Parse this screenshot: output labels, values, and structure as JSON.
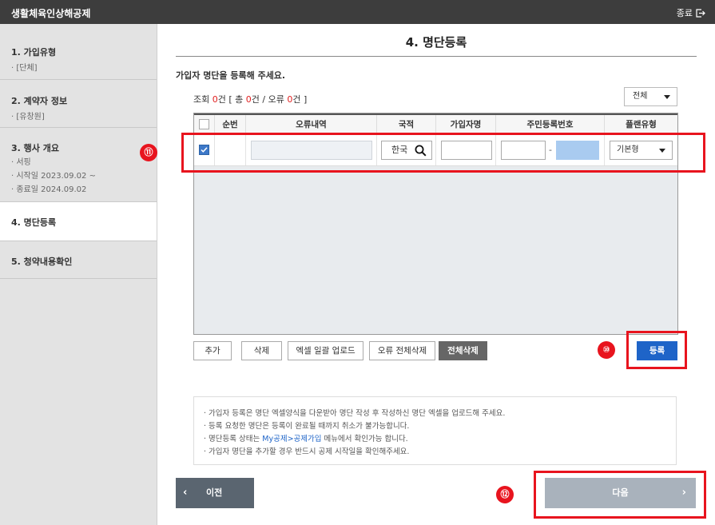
{
  "window": {
    "title": "생활체육인상해공제",
    "exit_label": "종료"
  },
  "sidebar": {
    "steps": [
      {
        "label": "1. 가입유형",
        "details": [
          "· [단체]"
        ]
      },
      {
        "label": "2. 계약자 정보",
        "details": [
          "· [유창원]"
        ]
      },
      {
        "label": "3. 행사 개요",
        "details": [
          "· 서핑",
          "· 시작일 2023.09.02 ~",
          "· 종료일 2024.09.02"
        ]
      },
      {
        "label": "4. 명단등록",
        "details": [],
        "active": true
      },
      {
        "label": "5. 청약내용확인",
        "details": []
      }
    ]
  },
  "main": {
    "title": "4. 명단등록",
    "intro": "가입자 명단을 등록해 주세요.",
    "count": {
      "prefix": "조회 ",
      "found": "0",
      "mid1": "건 [ 총 ",
      "total": "0",
      "mid2": "건 / 오류 ",
      "errors": "0",
      "suffix": "건 ]"
    },
    "filter": {
      "selected": "전체"
    },
    "table": {
      "columns": [
        "순번",
        "오류내역",
        "국적",
        "가입자명",
        "주민등록번호",
        "플랜유형"
      ],
      "rows": [
        {
          "checked": true,
          "seq": "",
          "error": "",
          "nationality": "한국",
          "name": "",
          "rrn_front": "",
          "rrn_sep": "-",
          "rrn_back": "",
          "plan": "기본형"
        }
      ]
    },
    "buttons": {
      "add": "추가",
      "delete": "삭제",
      "excel_upload": "엑셀 일괄 업로드",
      "delete_errors": "오류 전체삭제",
      "delete_all": "전체삭제",
      "register": "등록"
    },
    "notices": {
      "line1": "· 가입자 등록은 명단 엑셀양식을 다운받아 명단 작성 후 작성하신 명단 엑셀을 업로드해 주세요.",
      "line2": "· 등록 요청한 명단은 등록이 완료될 때까지 취소가 불가능합니다.",
      "line3_prefix": "· 명단등록 상태는 ",
      "line3_link": "My공제>공제가입",
      "line3_suffix": " 메뉴에서 확인가능 합니다.",
      "line4": "· 가입자 명단을 추가할 경우 반드시 공제 시작일을 확인해주세요."
    },
    "nav": {
      "prev": "이전",
      "next": "다음"
    }
  },
  "annotations": {
    "badge_11": "⑪",
    "badge_10": "⑩",
    "badge_12": "⑫"
  },
  "colors": {
    "accent": "#1e64c8",
    "highlight": "#e8141e",
    "count_red": "#e02020",
    "titlebar": "#3d3d3d"
  }
}
